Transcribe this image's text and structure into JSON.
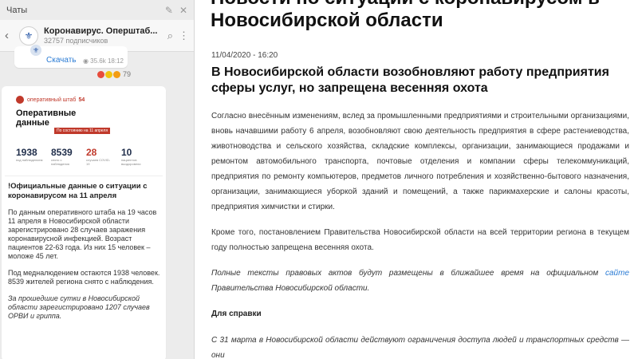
{
  "sidebar": {
    "top_label": "Чаты",
    "chat": {
      "name": "Коронавирус. Оперштаб Новосибирской...",
      "name_display": "Коронавирус. Оперштаб...",
      "subscribers": "32757 подписчиков"
    },
    "prev_message": {
      "share_label": "Скачать",
      "views": "35.6k",
      "time": "18:12"
    },
    "reactions_count": "79",
    "infocard": {
      "brand": "оперативный штаб",
      "brand_num": "54",
      "title_line1": "Оперативные",
      "title_line2": "данные",
      "date_label": "По состоянию на 11 апреля",
      "stats": [
        {
          "value": "1938",
          "label": "под наблюдением"
        },
        {
          "value": "8539",
          "label": "снято с наблюдения"
        },
        {
          "value": "28",
          "label": "случаев COVID-19"
        },
        {
          "value": "10",
          "label": "пациентов выздоровели"
        }
      ]
    },
    "message": {
      "headline": "!Официальные данные о ситуации с коронавирусом на 11 апреля",
      "p1": "По данным оперативного штаба на 19 часов 11 апреля в Новосибирской области зарегистрировано 28 случаев заражения коронавирусной инфекцией. Возраст пациентов 22-63 года. Из них 15 человек – моложе 45 лет.",
      "p2": "Под медналюдением остаются 1938 человек. 8539 жителей региона снято с наблюдения.",
      "p3": "За прошедшие сутки в Новосибирской области зарегистрировано 1207 случаев ОРВИ и гриппа."
    }
  },
  "article": {
    "header_line1": "Новости по ситуации с коронавирусом в",
    "header_line2": "Новосибирской области",
    "datetime": "11/04/2020 - 16:20",
    "title": "В Новосибирской области возобновляют работу предприятия сферы услуг, но запрещена весенняя охота",
    "p1": "Согласно внесённым изменениям, вслед за промышленными предприятиями и строительными организациями, вновь начавшими работу 6 апреля, возобновляют свою деятельность предприятия в сфере растениеводства, животноводства и сельского хозяйства, складские комплексы, организации, занимающиеся продажами и ремонтом автомобильного транспорта, почтовые отделения и компании сферы телекоммуникаций, предприятия по ремонту компьютеров, предметов личного потребления и хозяйственно-бытового назначения, организации, занимающиеся уборкой зданий и помещений, а также парикмахерские и салоны красоты, предприятия химчистки и стирки.",
    "p2": "Кроме того, постановлением Правительства Новосибирской области на всей территории региона в текущем году полностью запрещена весенняя охота.",
    "p3_before": "Полные тексты правовых актов будут размещены в ближайшее время на официальном ",
    "p3_link": "сайте",
    "p3_after": " Правительства Новосибирской области.",
    "ref_heading": "Для справки",
    "p4": "С 31 марта в Новосибирской области действуют ограничения доступа людей и транспортных средств — они"
  }
}
